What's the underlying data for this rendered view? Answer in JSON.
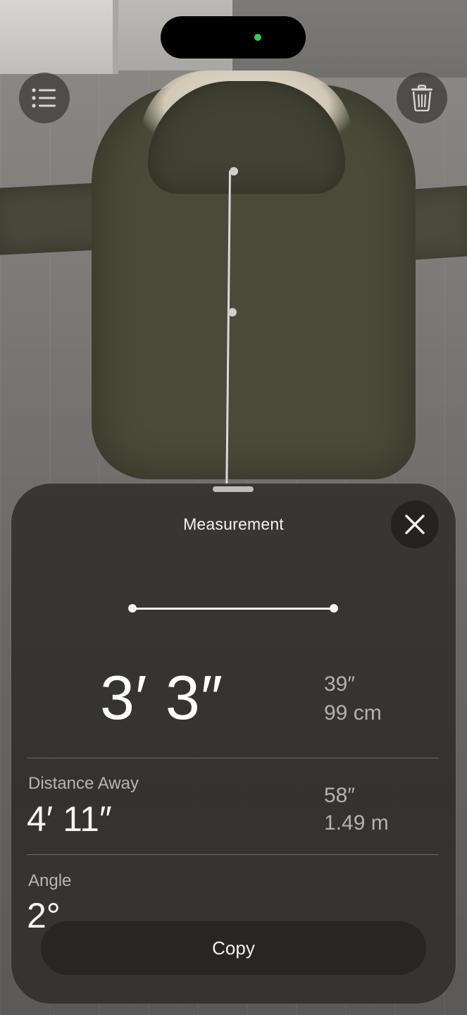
{
  "header": {
    "list_icon": "list-icon",
    "trash_icon": "trash-icon"
  },
  "sheet": {
    "title": "Measurement",
    "close_icon": "close-icon",
    "primary": {
      "value": "3′ 3″",
      "alt_inches": "39″",
      "alt_metric": "99 cm"
    },
    "distance": {
      "label": "Distance Away",
      "value": "4′ 11″",
      "alt_inches": "58″",
      "alt_metric": "1.49 m"
    },
    "angle": {
      "label": "Angle",
      "value": "2°"
    },
    "copy_label": "Copy"
  },
  "colors": {
    "camera_indicator": "#2dd34a",
    "sheet_bg": "#373533"
  }
}
